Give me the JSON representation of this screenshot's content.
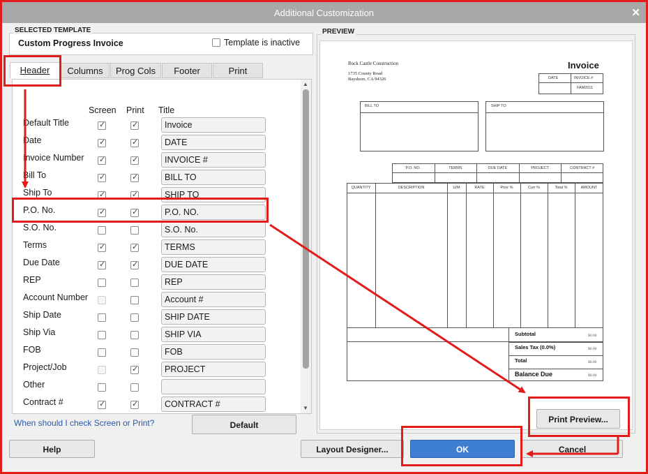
{
  "window": {
    "title": "Additional Customization",
    "close_glyph": "✕"
  },
  "selected_template": {
    "label": "SELECTED TEMPLATE",
    "name": "Custom Progress Invoice",
    "inactive_label": "Template is inactive",
    "inactive_checked": false
  },
  "tabs": [
    {
      "label": "Header",
      "active": true
    },
    {
      "label": "Columns",
      "active": false
    },
    {
      "label": "Prog Cols",
      "active": false
    },
    {
      "label": "Footer",
      "active": false
    },
    {
      "label": "Print",
      "active": false
    }
  ],
  "columns": {
    "screen": "Screen",
    "print": "Print",
    "title": "Title"
  },
  "rows": [
    {
      "label": "Default Title",
      "screen": true,
      "print": true,
      "title": "Invoice"
    },
    {
      "label": "Date",
      "screen": true,
      "print": true,
      "title": "DATE"
    },
    {
      "label": "Invoice Number",
      "screen": true,
      "print": true,
      "title": "INVOICE #"
    },
    {
      "label": "Bill To",
      "screen": true,
      "print": true,
      "title": "BILL TO"
    },
    {
      "label": "Ship To",
      "screen": true,
      "print": true,
      "title": "SHIP TO"
    },
    {
      "label": "P.O. No.",
      "screen": true,
      "print": true,
      "title": "P.O. NO."
    },
    {
      "label": "S.O. No.",
      "screen": false,
      "print": false,
      "title": "S.O. No."
    },
    {
      "label": "Terms",
      "screen": true,
      "print": true,
      "title": "TERMS"
    },
    {
      "label": "Due Date",
      "screen": true,
      "print": true,
      "title": "DUE DATE"
    },
    {
      "label": "REP",
      "screen": false,
      "print": false,
      "title": "REP"
    },
    {
      "label": "Account Number",
      "screen": false,
      "print": false,
      "screen_disabled": true,
      "title": "Account #"
    },
    {
      "label": "Ship Date",
      "screen": false,
      "print": false,
      "title": "SHIP DATE"
    },
    {
      "label": "Ship Via",
      "screen": false,
      "print": false,
      "title": "SHIP VIA"
    },
    {
      "label": "FOB",
      "screen": false,
      "print": false,
      "title": "FOB"
    },
    {
      "label": "Project/Job",
      "screen": false,
      "print": true,
      "screen_disabled": true,
      "title": "PROJECT"
    },
    {
      "label": "Other",
      "screen": false,
      "print": false,
      "title": ""
    },
    {
      "label": "Contract #",
      "screen": true,
      "print": true,
      "title": "CONTRACT #"
    }
  ],
  "help_link": "When should I check Screen or Print?",
  "default_button": "Default",
  "preview": {
    "label": "PREVIEW",
    "company_name": "Rock Castle Construction",
    "address_line1": "1735 County Road",
    "address_line2": "Bayshore, CA 94326",
    "doc_title": "Invoice",
    "date_label": "DATE",
    "invoice_label": "INVOICE #",
    "invoice_value": "FAM2011",
    "bill_to": "BILL TO",
    "ship_to": "SHIP TO",
    "header_fields": [
      "P.O. NO.",
      "TERMS",
      "DUE DATE",
      "PROJECT",
      "CONTRACT #"
    ],
    "line_columns": [
      "QUANTITY",
      "DESCRIPTION",
      "U/M",
      "RATE",
      "Prior %",
      "Curr %",
      "Total %",
      "AMOUNT"
    ],
    "totals": [
      {
        "label": "Subtotal",
        "amount": "$0.00"
      },
      {
        "label": "Sales Tax  (0.0%)",
        "amount": "$0.00"
      },
      {
        "label": "Total",
        "amount": "$0.00"
      },
      {
        "label": "Balance Due",
        "amount": "$0.00"
      }
    ]
  },
  "buttons": {
    "print_preview": "Print Preview...",
    "help": "Help",
    "layout_designer": "Layout Designer...",
    "ok": "OK",
    "cancel": "Cancel"
  },
  "colors": {
    "annotation_red": "#e21b1b",
    "ok_blue": "#3f7fd2",
    "link_blue": "#2b5aa8",
    "title_bar": "#a8a8a8"
  }
}
